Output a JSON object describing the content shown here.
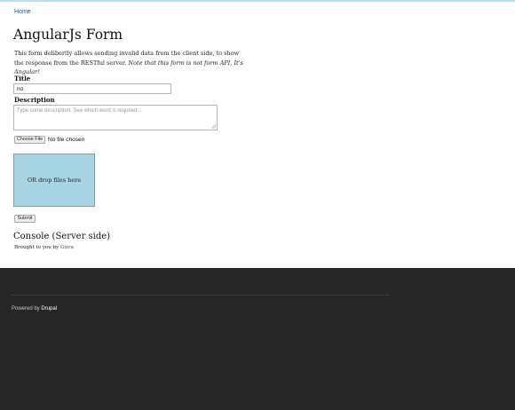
{
  "breadcrumb": {
    "home": "Home"
  },
  "page": {
    "title": "AngularJs Form",
    "intro_text": "This form delibertly allows sending invalid data from the client side, to show the response from the RESTful server.",
    "intro_note": "Note that this form is not form API, It's Angular!"
  },
  "form": {
    "title_label": "Title",
    "title_value": "no",
    "description_label": "Description",
    "description_placeholder": "Type some description. See which word is required...",
    "file_button": "Choose File",
    "file_status": "No file chosen",
    "drop_zone": "OR drop files here",
    "submit_label": "Submit"
  },
  "console": {
    "heading": "Console (Server side)",
    "credit_prefix": "Brought to you by",
    "credit_link": "Gizra"
  },
  "footer": {
    "powered_prefix": "Powered by",
    "powered_link": "Drupal"
  },
  "colors": {
    "link": "#0d5ba5",
    "drop_zone_bg": "#a8d5e4",
    "footer_bg": "#262626",
    "top_border": "#b9dff0"
  }
}
